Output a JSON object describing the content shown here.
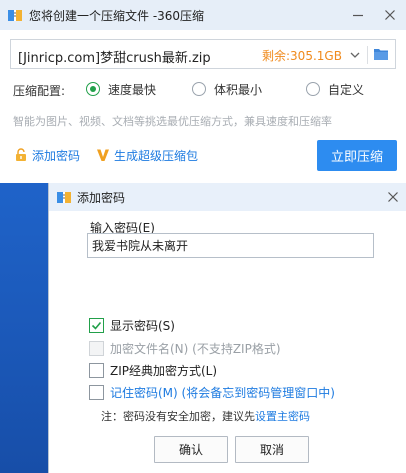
{
  "main_window": {
    "title": "您将创建一个压缩文件 -360压缩",
    "path_value": "[Jinricp.com]梦甜crush最新.zip",
    "free_space": "剩余:305.1GB",
    "config_label": "压缩配置:",
    "options": [
      {
        "label": "速度最快",
        "selected": true
      },
      {
        "label": "体积最小",
        "selected": false
      },
      {
        "label": "自定义",
        "selected": false
      }
    ],
    "hint": "智能为图片、视频、文档等挑选最优压缩方式，兼具速度和压缩率",
    "add_password_link": "添加密码",
    "super_package_link": "生成超级压缩包",
    "compress_button": "立即压缩"
  },
  "dialog": {
    "title": "添加密码",
    "password_label": "输入密码(E)",
    "password_value": "我爱书院从未离开",
    "checkboxes": [
      {
        "label": "显示密码(S)",
        "checked": true,
        "disabled": false
      },
      {
        "label": "加密文件名(N) (不支持ZIP格式)",
        "checked": false,
        "disabled": true
      },
      {
        "label": "ZIP经典加密方式(L)",
        "checked": false,
        "disabled": false
      },
      {
        "label": "记住密码(M) (将会备忘到密码管理窗口中)",
        "checked": false,
        "disabled": false
      }
    ],
    "note_prefix": "注：密码没有安全加密，建议先",
    "note_link": "设置主密码",
    "ok_button": "确认",
    "cancel_button": "取消"
  },
  "colors": {
    "accent_green": "#22a04a",
    "link_blue": "#1e7be0",
    "primary_button": "#2d8cf0",
    "free_space_orange": "#f08a1c"
  }
}
